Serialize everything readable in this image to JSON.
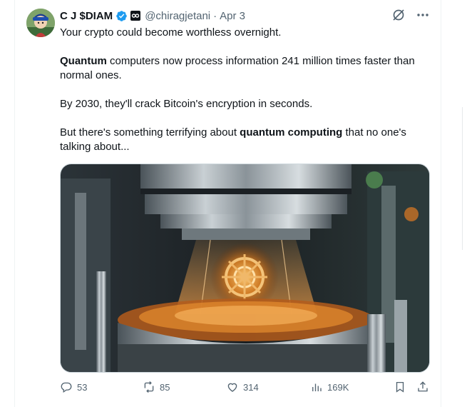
{
  "author": {
    "name": "C J $DIAM",
    "handle": "@chiragjetani",
    "separator": "·",
    "date": "Apr 3"
  },
  "tweet": {
    "p1": "Your crypto could become worthless overnight.",
    "p2_bold": "Quantum",
    "p2_rest": " computers now process information 241 million times faster than normal ones.",
    "p3": "By 2030, they'll crack Bitcoin's encryption in seconds.",
    "p4_start": "But there's something terrifying about ",
    "p4_bold": "quantum computing",
    "p4_end": " that no one's talking about..."
  },
  "metrics": {
    "replies": "53",
    "reposts": "85",
    "likes": "314",
    "views": "169K"
  },
  "icons": {
    "verified": "verified-badge-icon",
    "affiliate": "affiliate-icon",
    "grok": "grok-icon",
    "more": "more-icon",
    "reply": "reply-icon",
    "repost": "repost-icon",
    "like": "like-icon",
    "views": "views-icon",
    "bookmark": "bookmark-icon",
    "share": "share-icon"
  },
  "colors": {
    "text": "#0f1419",
    "secondary": "#536471",
    "verified": "#1d9bf0",
    "border": "#eff3f4"
  }
}
